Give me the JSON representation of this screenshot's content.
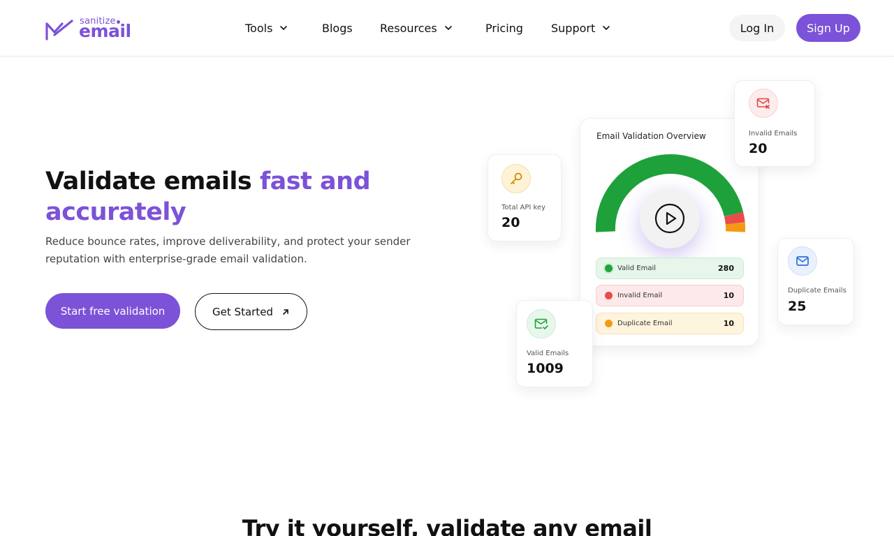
{
  "brand": {
    "small": "sanitize",
    "big": "email",
    "color": "#7c52d8"
  },
  "nav": {
    "items": [
      {
        "label": "Tools",
        "has_dropdown": true
      },
      {
        "label": "Blogs",
        "has_dropdown": false
      },
      {
        "label": "Resources",
        "has_dropdown": true
      },
      {
        "label": "Pricing",
        "has_dropdown": false
      },
      {
        "label": "Support",
        "has_dropdown": true
      }
    ],
    "login": "Log In",
    "signup": "Sign Up"
  },
  "hero": {
    "title_plain": "Validate emails ",
    "title_accent": "fast and accurately",
    "subtitle": "Reduce bounce rates, improve deliverability, and protect your sender reputation with enterprise-grade email validation.",
    "primary_cta": "Start free validation",
    "secondary_cta": "Get Started"
  },
  "dashboard": {
    "overview_title": "Email Validation Overview",
    "api_card": {
      "label": "Total API key",
      "value": "20",
      "icon": "key-icon"
    },
    "valid_card": {
      "label": "Valid Emails",
      "value": "1009",
      "icon": "mail-check-icon"
    },
    "invalid_card": {
      "label": "Invalid Emails",
      "value": "20",
      "icon": "mail-x-icon"
    },
    "duplicate_card": {
      "label": "Duplicate Emails",
      "value": "25",
      "icon": "mail-icon"
    },
    "rows": [
      {
        "label": "Valid Email",
        "value": "280",
        "color": "#20a43c"
      },
      {
        "label": "Invalid Email",
        "value": "10",
        "color": "#ea4b4b"
      },
      {
        "label": "Duplicate Email",
        "value": "10",
        "color": "#f39a12"
      }
    ]
  },
  "next_section": {
    "title": "Try it yourself, validate any email"
  }
}
